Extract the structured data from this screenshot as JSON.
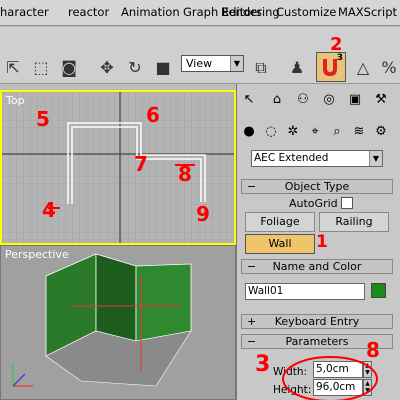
{
  "menu": [
    "haracter",
    "reactor",
    "Animation",
    "Graph Editors",
    "Rendering",
    "Customize",
    "MAXScript"
  ],
  "toolbar": {
    "view_select": "View",
    "snap_value": "3"
  },
  "viewports": {
    "top_label": "Top",
    "persp_label": "Perspective"
  },
  "command_panel": {
    "category_value": "AEC Extended",
    "object_type": {
      "title": "Object Type",
      "autogrid_label": "AutoGrid",
      "buttons": [
        "Foliage",
        "Railing",
        "Wall"
      ]
    },
    "name_color": {
      "title": "Name and Color",
      "name_value": "Wall01",
      "color": "#1a8a1a"
    },
    "keyboard_entry": {
      "title": "Keyboard Entry"
    },
    "parameters": {
      "title": "Parameters",
      "width_label": "Width:",
      "width_value": "5,0cm",
      "height_label": "Height:",
      "height_value": "96,0cm"
    }
  },
  "annotations": [
    "1",
    "2",
    "3",
    "4",
    "5",
    "6",
    "7",
    "8",
    "9",
    "1",
    "8"
  ],
  "colors": {
    "viewport_active_border": "#ffff00",
    "wall_button": "#f0c46a",
    "annotation": "#ff0000",
    "wall_color": "#1a8a1a"
  }
}
